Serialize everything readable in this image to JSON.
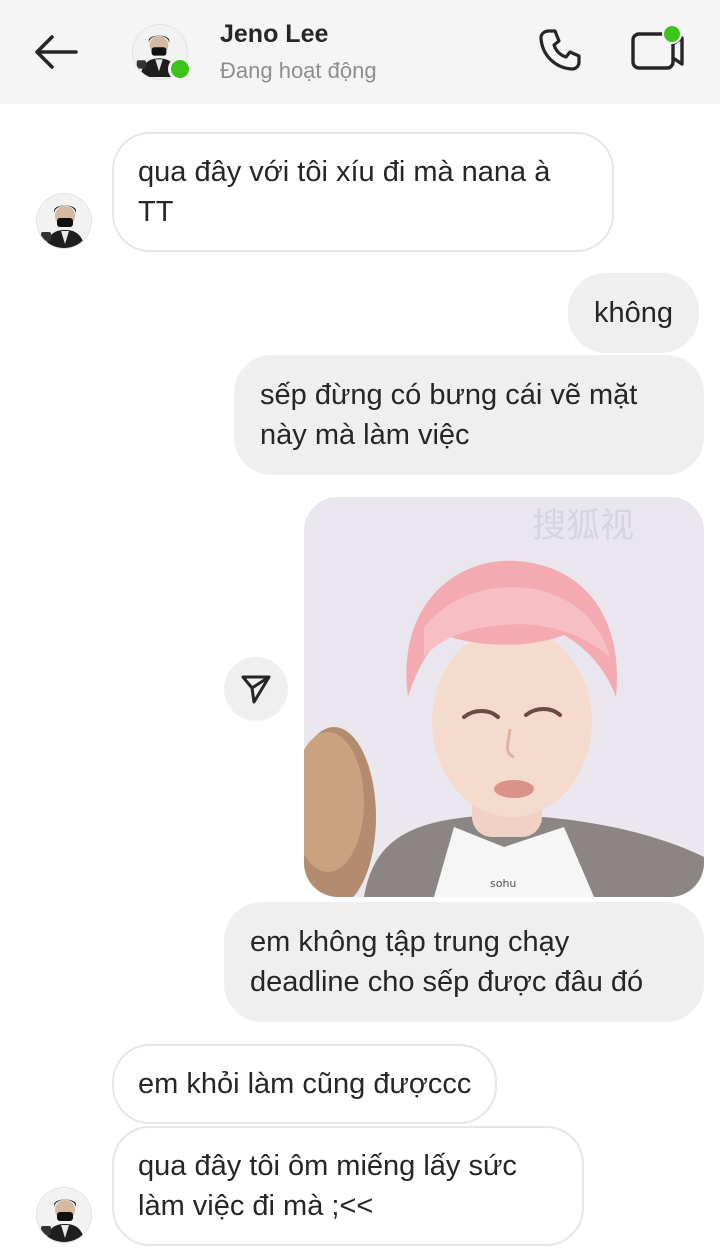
{
  "header": {
    "name": "Jeno Lee",
    "status": "Đang hoạt động",
    "online_color": "#3bc51a",
    "icons": [
      "arrow-left-icon",
      "phone-icon",
      "video-camera-icon"
    ]
  },
  "messages": [
    {
      "from": "contact",
      "text": "qua đây với tôi xíu đi mà nana à\nTT"
    },
    {
      "from": "me",
      "text": "không"
    },
    {
      "from": "me",
      "text": "sếp đừng có bưng cái vẽ mặt\nnày mà làm việc"
    },
    {
      "from": "me",
      "type": "image",
      "watermark": "搜狐视",
      "caption_mark": "sohu"
    },
    {
      "from": "me",
      "text": "em không tập trung chạy\ndeadline cho sếp được đâu đó"
    },
    {
      "from": "contact",
      "text": "em khỏi làm cũng đượccc"
    },
    {
      "from": "contact",
      "text": "qua đây tôi ôm miếng lấy sức\nlàm việc đi mà ;<<"
    }
  ]
}
